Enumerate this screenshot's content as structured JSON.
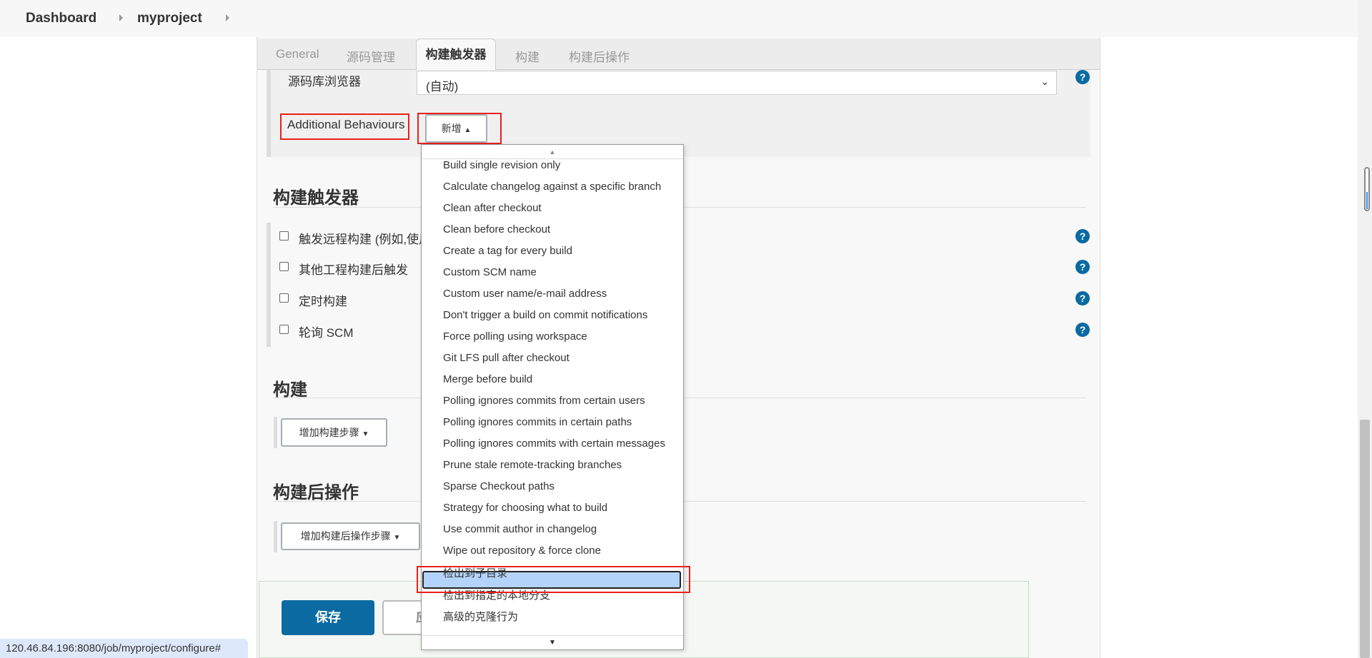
{
  "breadcrumb": [
    "Dashboard",
    "myproject"
  ],
  "tabs": [
    "General",
    "源码管理",
    "构建触发器",
    "构建",
    "构建后操作"
  ],
  "scm": {
    "browser_label": "源码库浏览器",
    "browser_value": "(自动)",
    "additional_label": "Additional Behaviours",
    "add_button": "新增"
  },
  "dropdown": {
    "items": [
      "Build single revision only",
      "Calculate changelog against a specific branch",
      "Clean after checkout",
      "Clean before checkout",
      "Create a tag for every build",
      "Custom SCM name",
      "Custom user name/e-mail address",
      "Don't trigger a build on commit notifications",
      "Force polling using workspace",
      "Git LFS pull after checkout",
      "Merge before build",
      "Polling ignores commits from certain users",
      "Polling ignores commits in certain paths",
      "Polling ignores commits with certain messages",
      "Prune stale remote-tracking branches",
      "Sparse Checkout paths",
      "Strategy for choosing what to build",
      "Use commit author in changelog",
      "Wipe out repository & force clone",
      "检出到子目录",
      "检出到指定的本地分支",
      "高级的克隆行为"
    ],
    "highlighted": "检出到子目录"
  },
  "triggers": {
    "title": "构建触发器",
    "options": [
      "触发远程构建 (例如,使用脚本)",
      "其他工程构建后触发",
      "定时构建",
      "轮询 SCM"
    ]
  },
  "build": {
    "title": "构建",
    "add_step": "增加构建步骤"
  },
  "post": {
    "title": "构建后操作",
    "add_step": "增加构建后操作步骤"
  },
  "actions": {
    "save": "保存",
    "apply": "应用"
  },
  "status_url": "120.46.84.196:8080/job/myproject/configure#",
  "colors": {
    "primary": "#0b6aa2",
    "highlight": "#b4d3fb",
    "annotation": "#e8201a"
  }
}
